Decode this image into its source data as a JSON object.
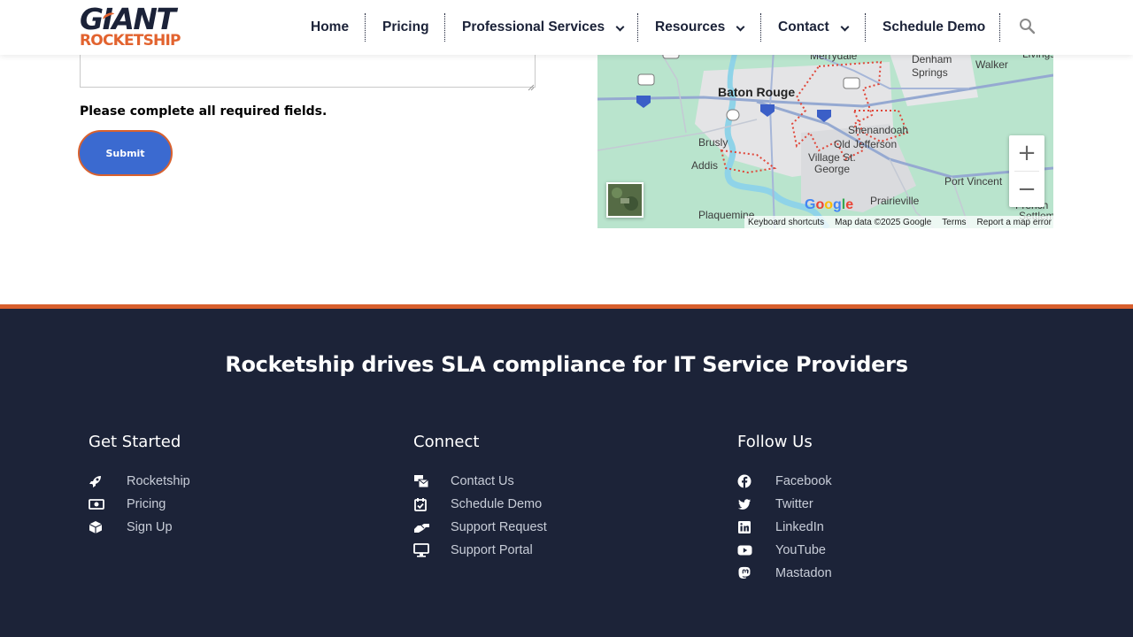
{
  "header": {
    "logo_top": "GIANT",
    "logo_bottom": "ROCKETSHIP",
    "nav": {
      "home": "Home",
      "pricing": "Pricing",
      "professional_services": "Professional Services",
      "resources": "Resources",
      "contact": "Contact",
      "schedule_demo": "Schedule Demo"
    }
  },
  "form": {
    "message_value": "",
    "required_notice": "Please complete all required fields.",
    "submit_label": "Submit"
  },
  "map": {
    "places": {
      "meriydale": "Merrydale",
      "denham": "Denham",
      "springs": "Springs",
      "walker": "Walker",
      "livingston": "Livingst",
      "baton_rouge": "Baton Rouge",
      "shenandoah": "Shenandoah",
      "old_jefferson": "Old Jefferson",
      "brusly": "Brusly",
      "addis": "Addis",
      "village_st": "Village St.",
      "george": "George",
      "port_vincent": "Port Vincent",
      "prairieville": "Prairieville",
      "plaquemine": "Plaquemine",
      "french": "French",
      "settlement": "Settlement"
    },
    "route_shields": [
      "190",
      "76",
      "10",
      "1",
      "10",
      "12",
      "190"
    ],
    "zoom_in": "+",
    "zoom_out": "−",
    "google_logo": "Google",
    "footer": {
      "shortcuts": "Keyboard shortcuts",
      "data": "Map data ©2025 Google",
      "terms": "Terms",
      "report": "Report a map error"
    }
  },
  "footer": {
    "tagline": "Rocketship drives SLA compliance for IT Service Providers",
    "columns": {
      "get_started": {
        "heading": "Get Started",
        "links": [
          "Rocketship",
          "Pricing",
          "Sign Up"
        ]
      },
      "connect": {
        "heading": "Connect",
        "links": [
          "Contact Us",
          "Schedule Demo",
          "Support Request",
          "Support Portal"
        ]
      },
      "follow_us": {
        "heading": "Follow Us",
        "links": [
          "Facebook",
          "Twitter",
          "LinkedIn",
          "YouTube",
          "Mastadon"
        ]
      }
    }
  },
  "colors": {
    "navy": "#1c2338",
    "orange": "#d85f2d",
    "submit_blue": "#3b6ad0",
    "map_green": "#b8e3cc"
  }
}
